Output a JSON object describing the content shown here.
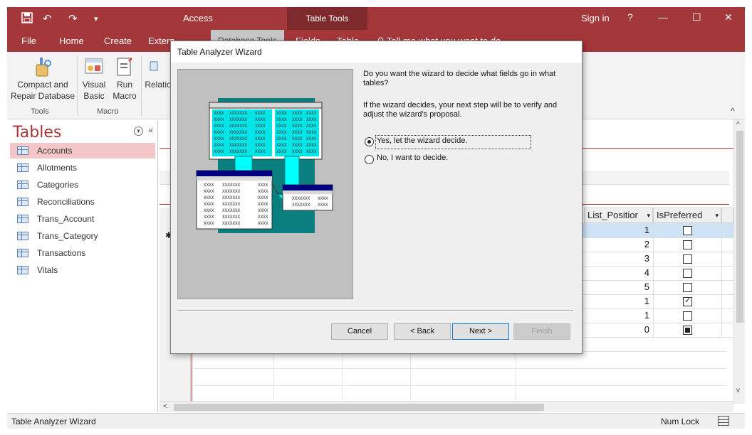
{
  "titlebar": {
    "app_title": "Access",
    "context_tab": "Table Tools",
    "sign_in": "Sign in",
    "help": "?",
    "minimize": "—",
    "maximize": "☐",
    "close": "✕",
    "save_icon": "💾",
    "undo": "↶",
    "redo": "↷",
    "customize": "▾"
  },
  "tabs": [
    "File",
    "Home",
    "Create",
    "Extern"
  ],
  "context_tabs": [
    "Database Tools",
    "Fields",
    "Table"
  ],
  "tell_me": "Tell me what you want to do",
  "ribbon": {
    "compact_label_1": "Compact and",
    "compact_label_2": "Repair Database",
    "visual_basic_1": "Visual",
    "visual_basic_2": "Basic",
    "run_macro_1": "Run",
    "run_macro_2": "Macro",
    "relationships": "Relatio",
    "group_tools": "Tools",
    "group_macro": "Macro",
    "collapse": "^"
  },
  "nav": {
    "title": "Tables",
    "items": [
      "Accounts",
      "Allotments",
      "Categories",
      "Reconciliations",
      "Trans_Account",
      "Trans_Category",
      "Transactions",
      "Vitals"
    ],
    "selected_index": 0
  },
  "datasheet": {
    "columns": [
      "List_Positior",
      "IsPreferred"
    ],
    "new_row_marker": "✱",
    "rows": [
      {
        "list_position": "1",
        "is_preferred": "unchecked"
      },
      {
        "list_position": "2",
        "is_preferred": "unchecked"
      },
      {
        "list_position": "3",
        "is_preferred": "unchecked"
      },
      {
        "list_position": "4",
        "is_preferred": "unchecked"
      },
      {
        "list_position": "5",
        "is_preferred": "unchecked"
      },
      {
        "list_position": "1",
        "is_preferred": "checked"
      },
      {
        "list_position": "1",
        "is_preferred": "unchecked"
      },
      {
        "list_position": "0",
        "is_preferred": "filled"
      }
    ]
  },
  "status": {
    "text": "Table Analyzer Wizard",
    "num_lock": "Num Lock"
  },
  "dialog": {
    "title": "Table Analyzer Wizard",
    "question_1": "Do you want the wizard to decide what fields go in what tables?",
    "question_2": "If the wizard decides, your next step will be to verify and adjust the wizard's proposal.",
    "option_yes": "Yes, let the wizard decide.",
    "option_no": "No, I want to decide.",
    "selected_option": "yes",
    "illustration_cell": "XXXX",
    "illustration_cell_long": "XXXXXXX",
    "buttons": {
      "cancel": "Cancel",
      "back": "< Back",
      "next": "Next >",
      "finish": "Finish"
    }
  },
  "colors": {
    "accent": "#a4373a",
    "accent_dark": "#7e2a2c",
    "selection": "#f4c7c8",
    "teal": "#0a7f80",
    "cyan": "#00ffff",
    "navy": "#000080"
  }
}
